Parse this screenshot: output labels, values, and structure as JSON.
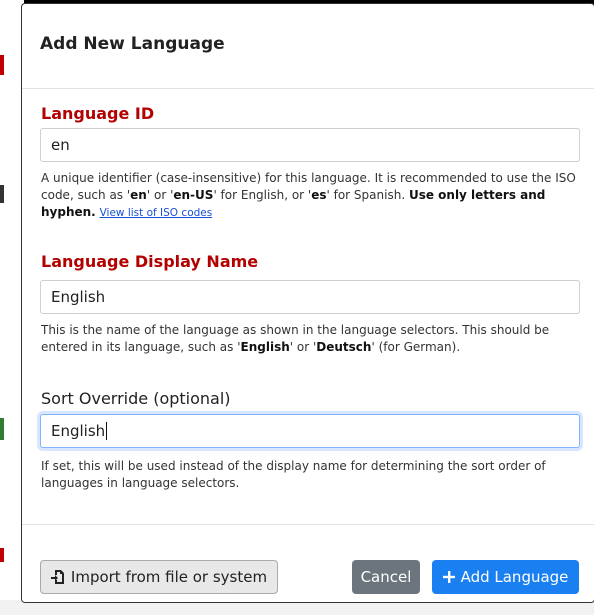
{
  "dialog": {
    "title": "Add New Language"
  },
  "language_id": {
    "label": "Language ID",
    "value": "en",
    "help_parts": {
      "p1": "A unique identifier (case-insensitive) for this language. It is recommended to use the ISO code, such as '",
      "b1": "en",
      "p2": "' or '",
      "b2": "en-US",
      "p3": "' for English, or '",
      "b3": "es",
      "p4": "' for Spanish. ",
      "b4": "Use only letters and hyphen.",
      "link": "View list of ISO codes"
    }
  },
  "display_name": {
    "label": "Language Display Name",
    "value": "English",
    "help_parts": {
      "p1": "This is the name of the language as shown in the language selectors. This should be entered in its language, such as '",
      "b1": "English",
      "p2": "' or '",
      "b2": "Deutsch",
      "p3": "' (for German)."
    }
  },
  "sort_override": {
    "label": "Sort Override (optional)",
    "value": "English",
    "help": "If set, this will be used instead of the display name for determining the sort order of languages in language selectors."
  },
  "footer": {
    "import_label": "Import from file or system",
    "cancel_label": "Cancel",
    "add_label": "Add Language",
    "add_icon": "plus-icon",
    "import_icon": "file-import-icon"
  },
  "colors": {
    "required_label": "#b30000",
    "primary": "#1a7ff0",
    "secondary": "#6c757d"
  }
}
